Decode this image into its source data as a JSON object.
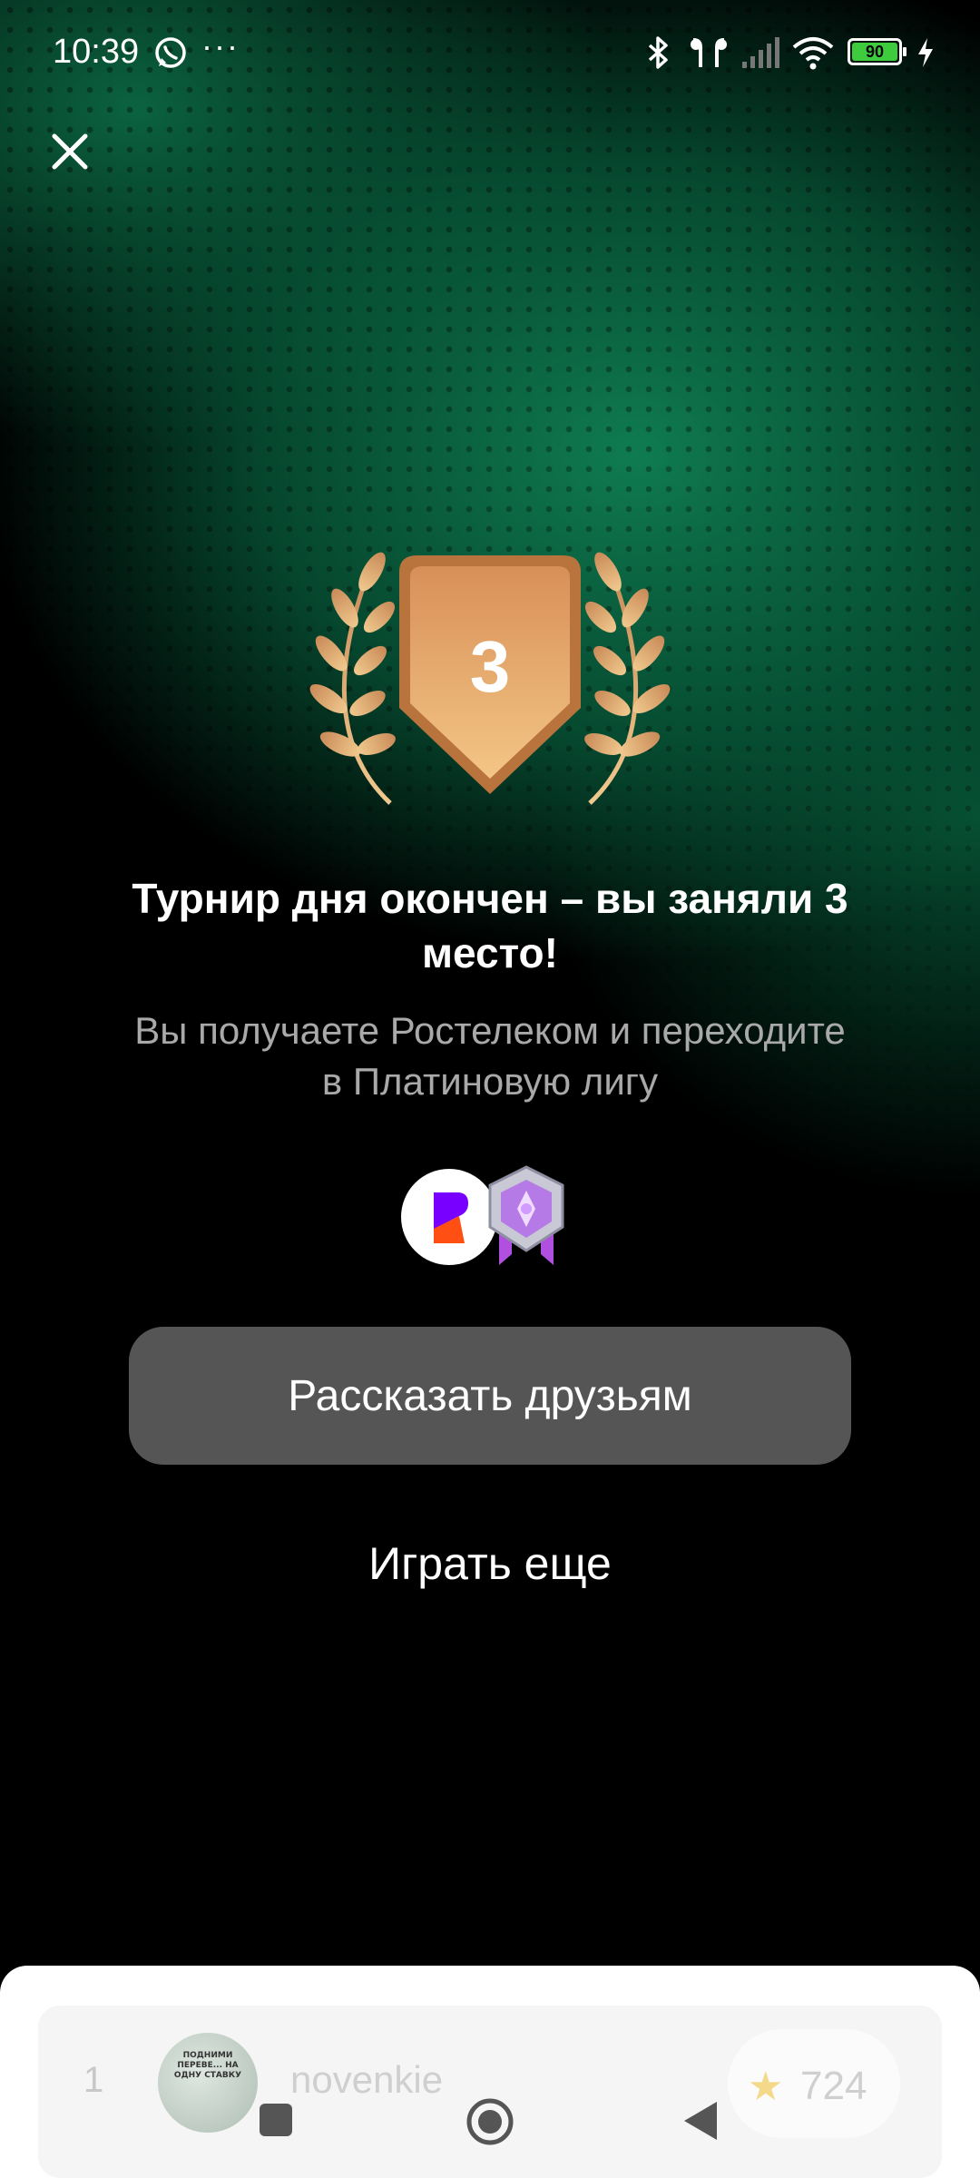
{
  "status_bar": {
    "time": "10:39",
    "more": "···",
    "battery": "90",
    "icons": [
      "whatsapp-icon",
      "bluetooth-icon",
      "earbuds-icon",
      "signal-icon",
      "wifi-icon",
      "battery-icon",
      "charging-icon"
    ]
  },
  "result": {
    "place": "3",
    "title": "Турнир дня окончен – вы заняли 3 место!",
    "subtitle": "Вы получаете Ростелеком и переходите в Платиновую лигу"
  },
  "actions": {
    "share_label": "Рассказать друзьям",
    "play_again_label": "Играть еще"
  },
  "leaderboard": {
    "rows": [
      {
        "rank": "1",
        "name": "novenkie",
        "score": "724",
        "avatar_caption": "ПОДНИМИ ПЕРЕВЕ... НА ОДНУ СТАВКУ"
      }
    ]
  },
  "colors": {
    "accent_green": "#0b7a52",
    "bronze": "#d99a62",
    "button_bg": "#555555"
  }
}
